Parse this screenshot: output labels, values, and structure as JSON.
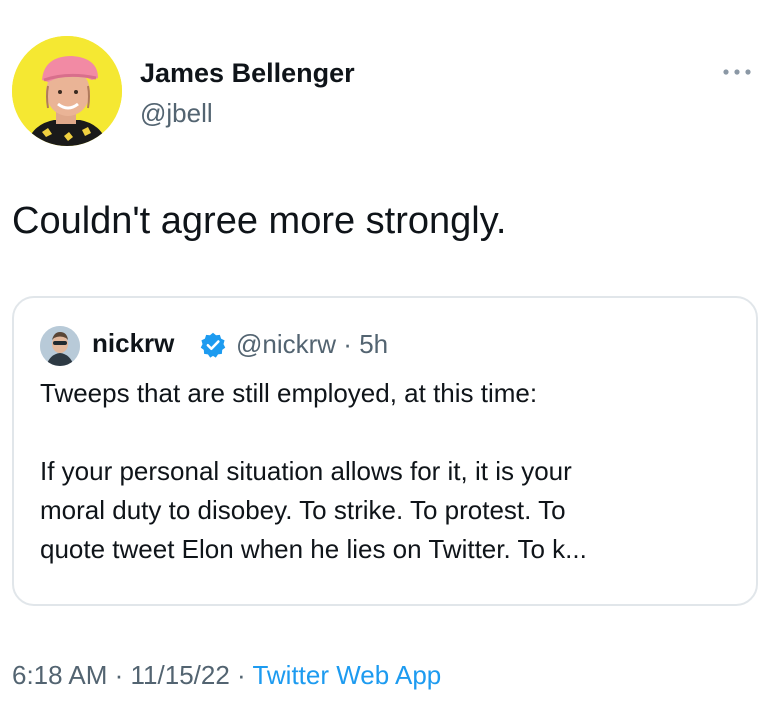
{
  "tweet": {
    "author_name": "James Bellenger",
    "author_handle": "@jbell",
    "text": "Couldn't agree more strongly.",
    "more_icon": "more-horizontal-icon",
    "time": "6:18 AM",
    "date": "11/15/22",
    "separator": " · ",
    "app": "Twitter Web App"
  },
  "quoted_tweet": {
    "author_name": "nickrw",
    "verified_icon": "verified-badge-icon",
    "author_handle": "@nickrw",
    "age": "5h",
    "separator": " · ",
    "lines": [
      "Tweeps that are still employed, at this time:",
      "If your personal situation allows for it, it is your",
      "moral duty to disobey. To strike. To protest. To",
      "quote tweet Elon when he lies on Twitter. To k..."
    ]
  },
  "colors": {
    "text": "#0f1419",
    "secondary": "#536471",
    "link": "#1d9bf0",
    "border": "#e1e6ea",
    "verified": "#1d9bf0",
    "avatar_bg": "#f5e832"
  }
}
